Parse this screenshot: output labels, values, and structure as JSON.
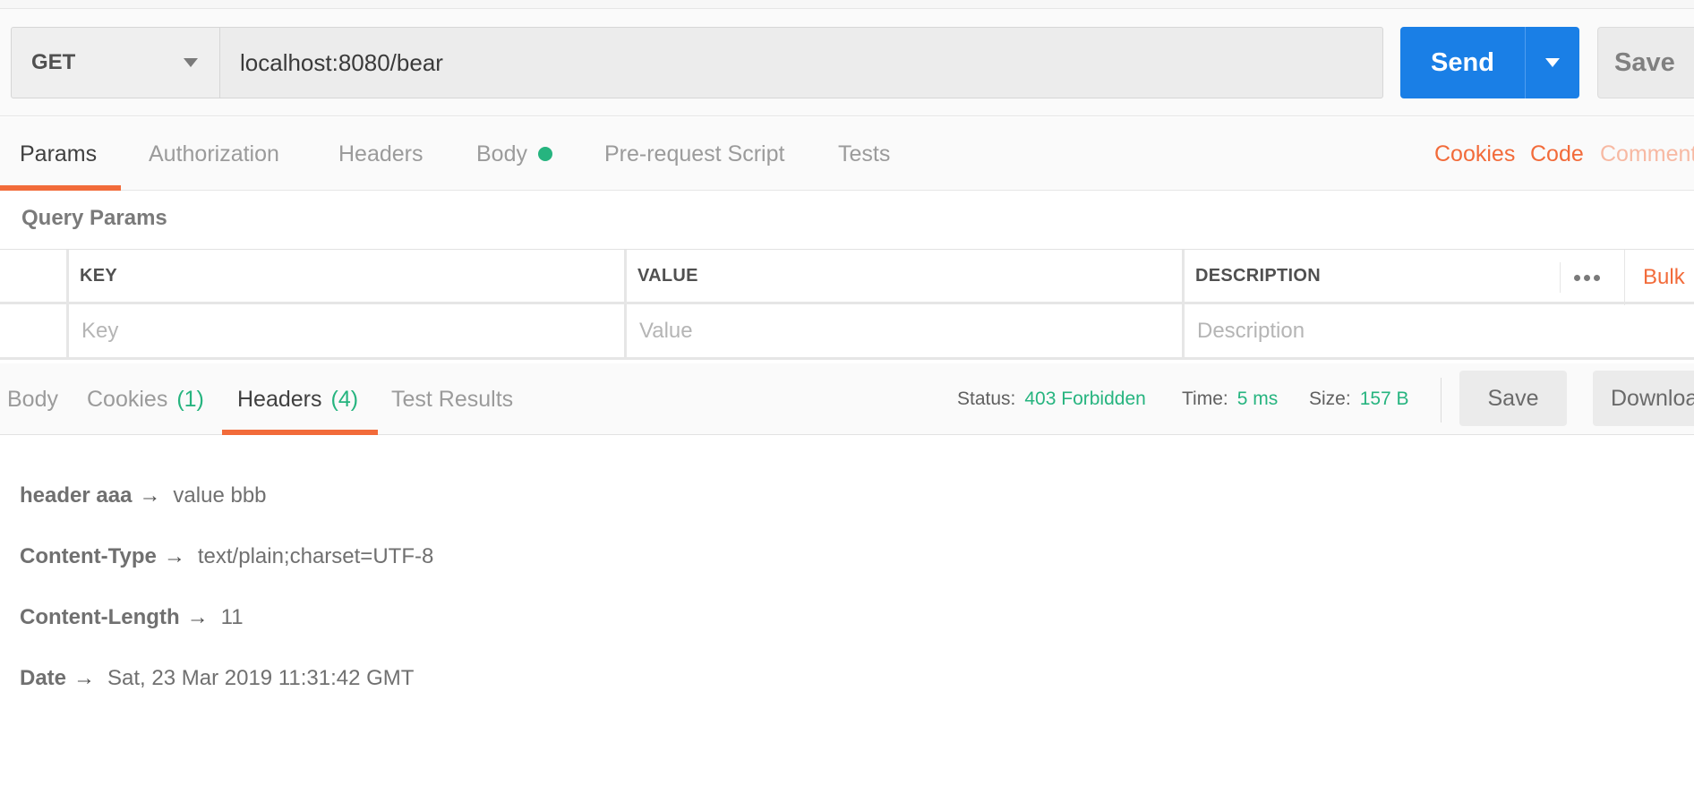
{
  "request": {
    "method": "GET",
    "url": "localhost:8080/bear",
    "send_label": "Send",
    "save_label": "Save"
  },
  "request_tabs": [
    {
      "label": "Params",
      "active": true
    },
    {
      "label": "Authorization"
    },
    {
      "label": "Headers"
    },
    {
      "label": "Body",
      "has_dot": true
    },
    {
      "label": "Pre-request Script"
    },
    {
      "label": "Tests"
    }
  ],
  "request_links": {
    "cookies": "Cookies",
    "code": "Code",
    "comments": "Comment"
  },
  "query_params": {
    "title": "Query Params",
    "columns": {
      "key": "KEY",
      "value": "VALUE",
      "description": "DESCRIPTION"
    },
    "placeholders": {
      "key": "Key",
      "value": "Value",
      "description": "Description"
    },
    "bulk_label": "Bulk"
  },
  "response": {
    "tabs": {
      "body": "Body",
      "cookies": "Cookies",
      "cookies_count": "(1)",
      "headers": "Headers",
      "headers_count": "(4)",
      "test_results": "Test Results"
    },
    "status_label": "Status:",
    "status_value": "403 Forbidden",
    "time_label": "Time:",
    "time_value": "5 ms",
    "size_label": "Size:",
    "size_value": "157 B",
    "save_label": "Save",
    "download_label": "Download",
    "headers": [
      {
        "key": "header aaa",
        "value": "value bbb"
      },
      {
        "key": "Content-Type",
        "value": "text/plain;charset=UTF-8"
      },
      {
        "key": "Content-Length",
        "value": "11"
      },
      {
        "key": "Date",
        "value": "Sat, 23 Mar 2019 11:31:42 GMT"
      }
    ],
    "arrow": "→"
  },
  "colors": {
    "accent": "#f26b3a",
    "send_blue": "#1a7fe6",
    "success_green": "#26b47f"
  }
}
